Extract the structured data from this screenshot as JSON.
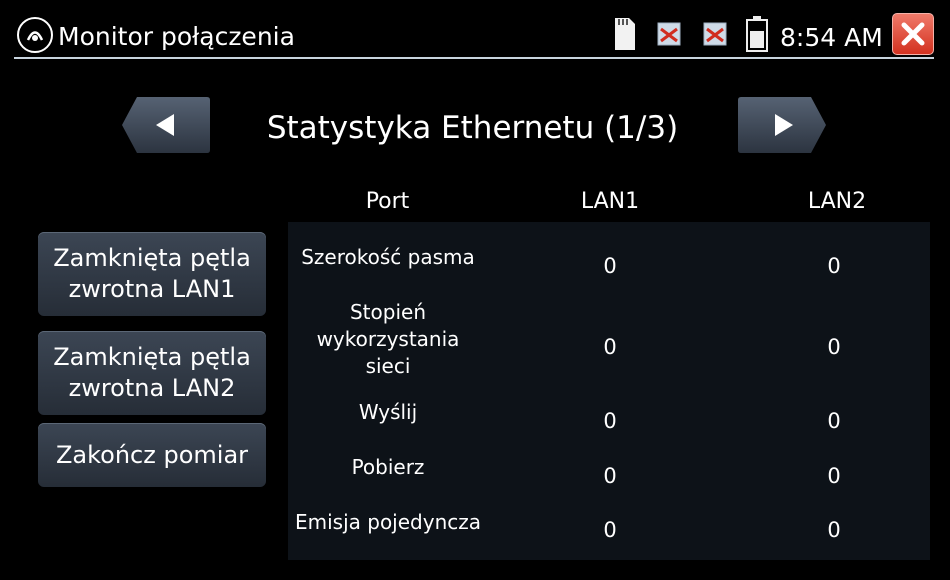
{
  "header": {
    "title": "Monitor połączenia",
    "time": "8:54 AM",
    "icons": [
      "network-monitor-icon",
      "sd-card-icon",
      "network-disconnected-icon",
      "network-disconnected-icon",
      "battery-icon",
      "close-icon"
    ]
  },
  "nav": {
    "title": "Statystyka Ethernetu (1/3)",
    "prev_icon": "triangle-left-icon",
    "next_icon": "triangle-right-icon"
  },
  "side_buttons": [
    "Zamknięta pętla\nzwrotna LAN1",
    "Zamknięta pętla\nzwrotna LAN2",
    "Zakończ pomiar"
  ],
  "table": {
    "headers": [
      "Port",
      "LAN1",
      "LAN2"
    ],
    "rows": [
      {
        "label": "Szerokość pasma",
        "lan1": "0",
        "lan2": "0"
      },
      {
        "label": "Stopień\nwykorzystania\nsieci",
        "lan1": "0",
        "lan2": "0"
      },
      {
        "label": "Wyślij",
        "lan1": "0",
        "lan2": "0"
      },
      {
        "label": "Pobierz",
        "lan1": "0",
        "lan2": "0"
      },
      {
        "label": "Emisja pojedyncza",
        "lan1": "0",
        "lan2": "0"
      }
    ]
  },
  "colors": {
    "close_button": "#d3311f",
    "button_bg": "#2f3844",
    "table_bg": "#0d1218"
  }
}
